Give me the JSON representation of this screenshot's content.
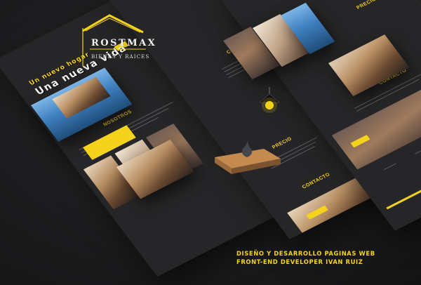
{
  "logo": {
    "brand": "ROSTMAX",
    "tagline": "BIENES Y RAICES"
  },
  "hero": {
    "line1": "Un nuevo hogar",
    "line2": "Una nueva vida"
  },
  "sections": {
    "nosotros": "NOSOTROS",
    "comodidad": "COMODIDAD",
    "precio": "PRECIO",
    "contacto": "CONTACTO",
    "contacto_dup": "CONTACTO"
  },
  "credits": {
    "line1": "DISEÑO Y DESARROLLO PAGINAS WEB",
    "line2": "FRONT-END DEVELOPER IVAN RUIZ"
  },
  "colors": {
    "accent": "#f5d21b",
    "background": "#1d1d1f",
    "page": "#262628"
  }
}
